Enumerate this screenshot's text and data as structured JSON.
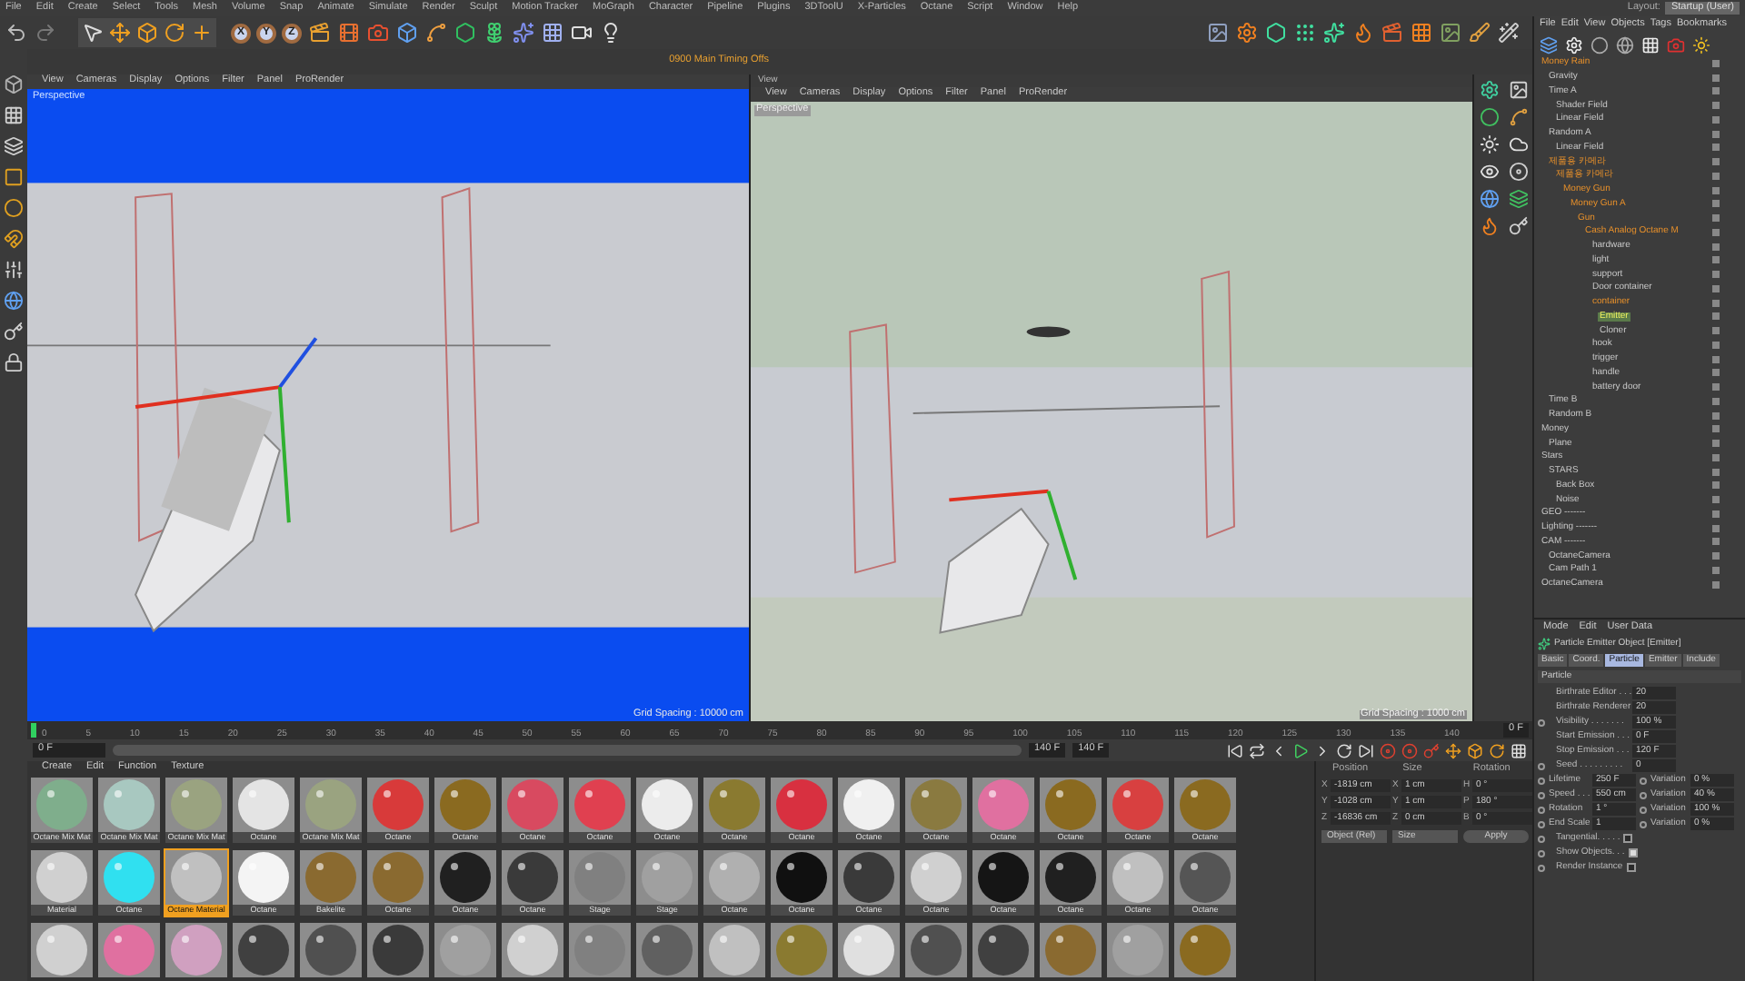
{
  "menu": [
    "File",
    "Edit",
    "Create",
    "Select",
    "Tools",
    "Mesh",
    "Volume",
    "Snap",
    "Animate",
    "Simulate",
    "Render",
    "Sculpt",
    "Motion Tracker",
    "MoGraph",
    "Character",
    "Pipeline",
    "Plugins",
    "3DToolU",
    "X-Particles",
    "Octane",
    "Script",
    "Window",
    "Help"
  ],
  "layout": {
    "label": "Layout:",
    "value": "Startup (User)"
  },
  "axis_buttons": [
    "X",
    "Y",
    "Z"
  ],
  "viewport_tab": "0900 Main Timing Offs",
  "viewports": [
    {
      "menu": [
        "View",
        "Cameras",
        "Display",
        "Options",
        "Filter",
        "Panel",
        "ProRender"
      ],
      "camera": "Perspective",
      "grid": "Grid Spacing : 10000 cm",
      "kind": "blue"
    },
    {
      "title": "View",
      "menu": [
        "View",
        "Cameras",
        "Display",
        "Options",
        "Filter",
        "Panel",
        "ProRender"
      ],
      "camera": "Perspective",
      "grid": "Grid Spacing : 1000 cm",
      "kind": "gray"
    }
  ],
  "objects": {
    "menu": [
      "File",
      "Edit",
      "View",
      "Objects",
      "Tags",
      "Bookmarks"
    ],
    "tree": [
      {
        "name": "Money Rain",
        "highlighted": true,
        "selected": false,
        "children": [
          {
            "name": "Gravity",
            "highlighted": false,
            "selected": false
          },
          {
            "name": "Time A",
            "highlighted": false,
            "selected": false,
            "children": [
              {
                "name": "Shader Field",
                "highlighted": false,
                "selected": false
              },
              {
                "name": "Linear Field",
                "highlighted": false,
                "selected": false
              }
            ]
          },
          {
            "name": "Random A",
            "highlighted": false,
            "selected": false,
            "children": [
              {
                "name": "Linear Field",
                "highlighted": false,
                "selected": false
              }
            ]
          },
          {
            "name": "제품용 카메라",
            "highlighted": true,
            "selected": false,
            "children": [
              {
                "name": "제품용 카메라",
                "highlighted": true,
                "selected": false,
                "children": [
                  {
                    "name": "Money Gun",
                    "highlighted": true,
                    "selected": false,
                    "children": [
                      {
                        "name": "Money Gun A",
                        "highlighted": true,
                        "selected": false,
                        "children": [
                          {
                            "name": "Gun",
                            "highlighted": true,
                            "selected": false,
                            "children": [
                              {
                                "name": "Cash Analog Octane M",
                                "highlighted": true,
                                "selected": false,
                                "children": [
                                  {
                                    "name": "hardware",
                                    "highlighted": false,
                                    "selected": false
                                  },
                                  {
                                    "name": "light",
                                    "highlighted": false,
                                    "selected": false
                                  },
                                  {
                                    "name": "support",
                                    "highlighted": false,
                                    "selected": false
                                  },
                                  {
                                    "name": "Door container",
                                    "highlighted": false,
                                    "selected": false
                                  },
                                  {
                                    "name": "container",
                                    "highlighted": true,
                                    "selected": false,
                                    "children": [
                                      {
                                        "name": "Emitter",
                                        "highlighted": false,
                                        "selected": true
                                      },
                                      {
                                        "name": "Cloner",
                                        "highlighted": false,
                                        "selected": false
                                      }
                                    ]
                                  },
                                  {
                                    "name": "hook",
                                    "highlighted": false,
                                    "selected": false
                                  },
                                  {
                                    "name": "trigger",
                                    "highlighted": false,
                                    "selected": false
                                  },
                                  {
                                    "name": "handle",
                                    "highlighted": false,
                                    "selected": false
                                  },
                                  {
                                    "name": "battery door",
                                    "highlighted": false,
                                    "selected": false
                                  }
                                ]
                              }
                            ]
                          }
                        ]
                      }
                    ]
                  }
                ]
              }
            ]
          },
          {
            "name": "Time B",
            "highlighted": false,
            "selected": false
          },
          {
            "name": "Random B",
            "highlighted": false,
            "selected": false
          }
        ]
      },
      {
        "name": "Money",
        "highlighted": false,
        "selected": false,
        "children": [
          {
            "name": "Plane",
            "highlighted": false,
            "selected": false
          }
        ]
      },
      {
        "name": "Stars",
        "highlighted": false,
        "selected": false,
        "children": [
          {
            "name": "STARS",
            "highlighted": false,
            "selected": false,
            "children": [
              {
                "name": "Back Box",
                "highlighted": false,
                "selected": false
              },
              {
                "name": "Noise",
                "highlighted": false,
                "selected": false
              }
            ]
          }
        ]
      },
      {
        "name": "GEO -------",
        "highlighted": false,
        "selected": false
      },
      {
        "name": "Lighting -------",
        "highlighted": false,
        "selected": false
      },
      {
        "name": "CAM -------",
        "highlighted": false,
        "selected": false,
        "children": [
          {
            "name": "OctaneCamera",
            "highlighted": false,
            "selected": false
          },
          {
            "name": "Cam Path 1",
            "highlighted": false,
            "selected": false
          }
        ]
      },
      {
        "name": "OctaneCamera",
        "highlighted": false,
        "selected": false
      }
    ]
  },
  "attributes": {
    "menu": [
      "Mode",
      "Edit",
      "User Data"
    ],
    "title": "Particle Emitter Object [Emitter]",
    "tabs": [
      {
        "label": "Basic",
        "selected": false
      },
      {
        "label": "Coord.",
        "selected": false
      },
      {
        "label": "Particle",
        "selected": true
      },
      {
        "label": "Emitter",
        "selected": false
      },
      {
        "label": "Include",
        "selected": false
      }
    ],
    "section": "Particle",
    "params": [
      {
        "kind": "field",
        "label": "Birthrate Editor . . .",
        "value": "20",
        "keyframe_dot": false
      },
      {
        "kind": "field",
        "label": "Birthrate Renderer",
        "value": "20",
        "keyframe_dot": false
      },
      {
        "kind": "field",
        "label": "Visibility . . . . . . .",
        "value": "100 %",
        "keyframe_dot": true
      },
      {
        "kind": "field",
        "label": "Start Emission . . .",
        "value": "0 F",
        "keyframe_dot": false
      },
      {
        "kind": "field",
        "label": "Stop Emission . . .",
        "value": "120 F",
        "keyframe_dot": false
      },
      {
        "kind": "field",
        "label": "Seed . . . . . . . . .",
        "value": "0",
        "keyframe_dot": true
      },
      {
        "kind": "pair",
        "label": "Lifetime",
        "value": "250 F",
        "label2": "Variation",
        "value2": "0 %",
        "keyframe_dot": true
      },
      {
        "kind": "pair",
        "label": "Speed . . .",
        "value": "550 cm",
        "label2": "Variation",
        "value2": "40 %",
        "keyframe_dot": true
      },
      {
        "kind": "pair",
        "label": "Rotation",
        "value": "1 °",
        "label2": "Variation",
        "value2": "100 %",
        "keyframe_dot": true
      },
      {
        "kind": "pair",
        "label": "End Scale",
        "value": "1",
        "label2": "Variation",
        "value2": "0 %",
        "keyframe_dot": true
      },
      {
        "kind": "checkbox",
        "label": "Tangential. . . . .",
        "checked": false,
        "keyframe_dot": true
      },
      {
        "kind": "checkbox",
        "label": "Show Objects. . .",
        "checked": true,
        "keyframe_dot": true
      },
      {
        "kind": "checkbox",
        "label": "Render Instance",
        "checked": false,
        "keyframe_dot": true
      }
    ]
  },
  "timeline": {
    "ticks": [
      "0",
      "5",
      "10",
      "15",
      "20",
      "25",
      "30",
      "35",
      "40",
      "45",
      "50",
      "55",
      "60",
      "65",
      "70",
      "75",
      "80",
      "85",
      "90",
      "95",
      "100",
      "105",
      "110",
      "115",
      "120",
      "125",
      "130",
      "135",
      "140"
    ],
    "current": "0 F",
    "start": "0 F",
    "end": "140 F",
    "max": "140 F",
    "level": 0
  },
  "materials": {
    "menu": [
      "Create",
      "Edit",
      "Function",
      "Texture"
    ],
    "items": [
      {
        "name": "Octane Mix Mat",
        "color": "#7fae8c",
        "selected": false
      },
      {
        "name": "Octane Mix Mat",
        "color": "#a8c8c0",
        "selected": false
      },
      {
        "name": "Octane Mix Mat",
        "color": "#9aa380",
        "selected": false
      },
      {
        "name": "Octane",
        "color": "#e4e4e4",
        "selected": false
      },
      {
        "name": "Octane Mix Mat",
        "color": "#9aa380",
        "selected": false
      },
      {
        "name": "Octane",
        "color": "#d83a3a",
        "selected": false
      },
      {
        "name": "Octane",
        "color": "#8a6a20",
        "selected": false
      },
      {
        "name": "Octane",
        "color": "#d84a60",
        "selected": false
      },
      {
        "name": "Octane",
        "color": "#e04050",
        "selected": false
      },
      {
        "name": "Octane",
        "color": "#ececec",
        "selected": false
      },
      {
        "name": "Octane",
        "color": "#8a7a30",
        "selected": false
      },
      {
        "name": "Octane",
        "color": "#d83040",
        "selected": false
      },
      {
        "name": "Octane",
        "color": "#f0f0f0",
        "selected": false
      },
      {
        "name": "Octane",
        "color": "#8a7a40",
        "selected": false
      },
      {
        "name": "Octane",
        "color": "#e070a0",
        "selected": false
      },
      {
        "name": "Octane",
        "color": "#8a6a20",
        "selected": false
      },
      {
        "name": "Octane",
        "color": "#d84040",
        "selected": false
      },
      {
        "name": "Octane",
        "color": "#8a6a20",
        "selected": false
      },
      {
        "name": "Material",
        "color": "#d0d0d0",
        "selected": false
      },
      {
        "name": "Octane",
        "color": "#30e0f0",
        "selected": false
      },
      {
        "name": "Octane Material",
        "color": "#c0c0c0",
        "selected": true
      },
      {
        "name": "Octane",
        "color": "#f4f4f4",
        "selected": false
      },
      {
        "name": "Bakelite",
        "color": "#8a6a30",
        "selected": false
      },
      {
        "name": "Octane",
        "color": "#8a6a30",
        "selected": false
      },
      {
        "name": "Octane",
        "color": "#202020",
        "selected": false
      },
      {
        "name": "Octane",
        "color": "#3a3a3a",
        "selected": false
      },
      {
        "name": "Stage",
        "color": "#808080",
        "selected": false
      },
      {
        "name": "Stage",
        "color": "#a0a0a0",
        "selected": false
      },
      {
        "name": "Octane",
        "color": "#b0b0b0",
        "selected": false
      },
      {
        "name": "Octane",
        "color": "#101010",
        "selected": false
      },
      {
        "name": "Octane",
        "color": "#3a3a3a",
        "selected": false
      },
      {
        "name": "Octane",
        "color": "#d0d0d0",
        "selected": false
      },
      {
        "name": "Octane",
        "color": "#151515",
        "selected": false
      },
      {
        "name": "Octane",
        "color": "#202020",
        "selected": false
      },
      {
        "name": "Octane",
        "color": "#c0c0c0",
        "selected": false
      },
      {
        "name": "Octane",
        "color": "#555555",
        "selected": false
      },
      {
        "color": "#d0d0d0",
        "selected": false
      },
      {
        "color": "#e070a0",
        "selected": false
      },
      {
        "color": "#d0a0c0",
        "selected": false
      },
      {
        "color": "#404040",
        "selected": false
      },
      {
        "color": "#505050",
        "selected": false
      },
      {
        "color": "#3a3a3a",
        "selected": false
      },
      {
        "color": "#a0a0a0",
        "selected": false
      },
      {
        "color": "#d0d0d0",
        "selected": false
      },
      {
        "color": "#808080",
        "selected": false
      },
      {
        "color": "#606060",
        "selected": false
      },
      {
        "color": "#c0c0c0",
        "selected": false
      },
      {
        "color": "#8a7a30",
        "selected": false
      },
      {
        "color": "#e0e0e0",
        "selected": false
      },
      {
        "color": "#505050",
        "selected": false
      },
      {
        "color": "#404040",
        "selected": false
      },
      {
        "color": "#8a6a30",
        "selected": false
      },
      {
        "color": "#a0a0a0",
        "selected": false
      },
      {
        "color": "#8a6a20",
        "selected": false
      }
    ]
  },
  "coordinates": {
    "headers": [
      "Position",
      "Size",
      "Rotation"
    ],
    "rows": [
      {
        "axis": "X",
        "position": "-1819 cm",
        "size_axis": "X",
        "size": "1 cm",
        "rot_axis": "H",
        "rotation": "0 °"
      },
      {
        "axis": "Y",
        "position": "-1028 cm",
        "size_axis": "Y",
        "size": "1 cm",
        "rot_axis": "P",
        "rotation": "180 °"
      },
      {
        "axis": "Z",
        "position": "-16836 cm",
        "size_axis": "Z",
        "size": "0 cm",
        "rot_axis": "B",
        "rotation": "0 °"
      }
    ],
    "mode": "Object (Rel)",
    "size_mode": "Size",
    "apply": "Apply"
  }
}
